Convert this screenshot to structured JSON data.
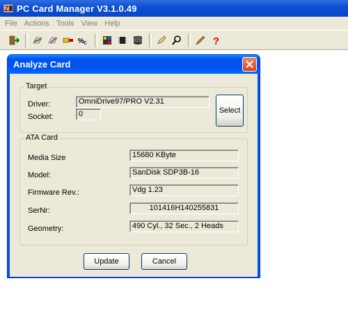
{
  "app": {
    "title": "PC Card Manager V3.1.0.49"
  },
  "menu": {
    "items": [
      "File",
      "Actions",
      "Tools",
      "View",
      "Help"
    ]
  },
  "toolbar": {
    "icons": [
      "exit-icon",
      "open-icon",
      "save-icon",
      "memory-card-icon",
      "ata-card-icon",
      "flash-icon",
      "chip-icon",
      "disk-icon",
      "edit-icon",
      "search-icon",
      "pencil-icon",
      "help-icon"
    ]
  },
  "dialog": {
    "title": "Analyze Card",
    "target": {
      "legend": "Target",
      "driver_label": "Driver:",
      "driver_value": "OmniDrive97/PRO  V2.31",
      "socket_label": "Socket:",
      "socket_value": "0",
      "select_label": "Select"
    },
    "ata": {
      "legend": "ATA Card",
      "rows": [
        {
          "label": "Media Size",
          "value": "15680 KByte"
        },
        {
          "label": "Model:",
          "value": "SanDisk SDP3B-16"
        },
        {
          "label": "Firmware Rev.:",
          "value": "Vdg 1.23"
        },
        {
          "label": "SerNr:",
          "value": "101416H140255831"
        },
        {
          "label": "Geometry:",
          "value": "490 Cyl., 32 Sec., 2 Heads"
        }
      ]
    },
    "update_label": "Update",
    "cancel_label": "Cancel"
  }
}
